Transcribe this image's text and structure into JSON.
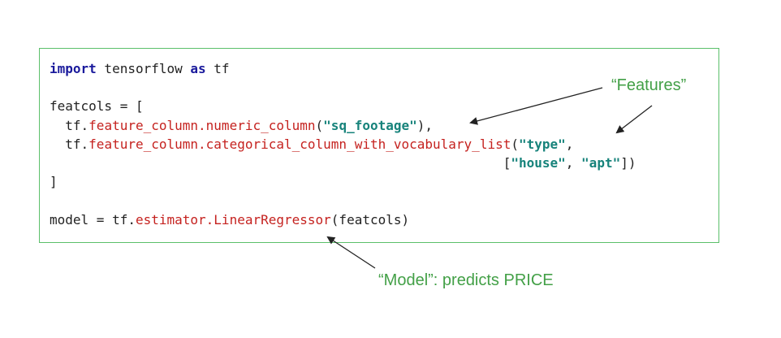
{
  "code": {
    "line1": {
      "kw1": "import",
      "mid": " tensorflow ",
      "kw2": "as",
      "tail": " tf"
    },
    "line3": {
      "text": "featcols = ["
    },
    "line4": {
      "indent": "  tf.",
      "fn": "feature_column.numeric_column",
      "open": "(",
      "str": "\"sq_footage\"",
      "close": "),"
    },
    "line5": {
      "indent": "  tf.",
      "fn": "feature_column.categorical_column_with_vocabulary_list",
      "open": "(",
      "str": "\"type\"",
      "close": ","
    },
    "line6": {
      "indent": "                                                          [",
      "str1": "\"house\"",
      "sep": ", ",
      "str2": "\"apt\"",
      "close": "])"
    },
    "line7": {
      "text": "]"
    },
    "line9": {
      "pre": "model = tf.",
      "fn": "estimator.LinearRegressor",
      "post": "(featcols)"
    }
  },
  "annotations": {
    "features": "“Features”",
    "model": "“Model”: predicts PRICE"
  },
  "colors": {
    "border": "#5bbf6a",
    "annotation": "#43a047",
    "keyword": "#1a1a9c",
    "function": "#c5221f",
    "string": "#17837b"
  }
}
